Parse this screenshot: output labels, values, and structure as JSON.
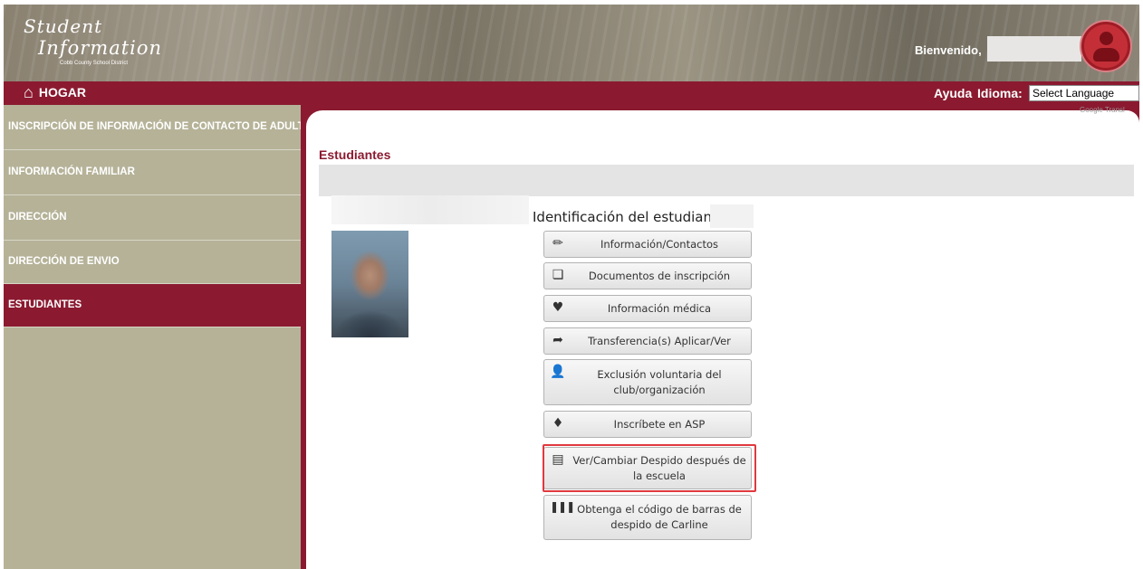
{
  "header": {
    "logo_line1": "Student",
    "logo_line2": "Information",
    "logo_district": "Cobb County School District",
    "welcome": "Bienvenido,"
  },
  "navbar": {
    "home_label": "HOGAR",
    "help_label": "Ayuda",
    "language_label": "Idioma:",
    "language_select_value": "Select Language",
    "google_translate_fragment": "Google Transl"
  },
  "sidebar": {
    "items": [
      {
        "label": "INSCRIPCIÓN DE INFORMACIÓN DE CONTACTO DE ADULTOS",
        "active": false
      },
      {
        "label": "INFORMACIÓN FAMILIAR",
        "active": false
      },
      {
        "label": "DIRECCIÓN",
        "active": false
      },
      {
        "label": "DIRECCIÓN DE ENVIO",
        "active": false
      },
      {
        "label": "ESTUDIANTES",
        "active": true
      }
    ]
  },
  "main": {
    "title": "Estudiantes",
    "student_id_label": "Identificación del estudiante:",
    "actions": [
      {
        "icon": "pencil-icon",
        "label": "Información/Contactos"
      },
      {
        "icon": "documents-icon",
        "label": "Documentos de inscripción"
      },
      {
        "icon": "heart-pulse-icon",
        "label": "Información médica"
      },
      {
        "icon": "share-arrow-icon",
        "label": "Transferencia(s) Aplicar/Ver"
      },
      {
        "icon": "user-minus-icon",
        "label": "Exclusión voluntaria del club/organización"
      },
      {
        "icon": "bell-icon",
        "label": "Inscríbete en ASP"
      },
      {
        "icon": "bus-icon",
        "label": "Ver/Cambiar Despido después de la escuela",
        "highlighted": true
      },
      {
        "icon": "barcode-icon",
        "label": "Obtenga el código de barras de despido de Carline"
      }
    ]
  },
  "colors": {
    "brand_maroon": "#8b1a30",
    "sidebar_bg": "#b5b298",
    "highlight_red": "#e0393f"
  }
}
